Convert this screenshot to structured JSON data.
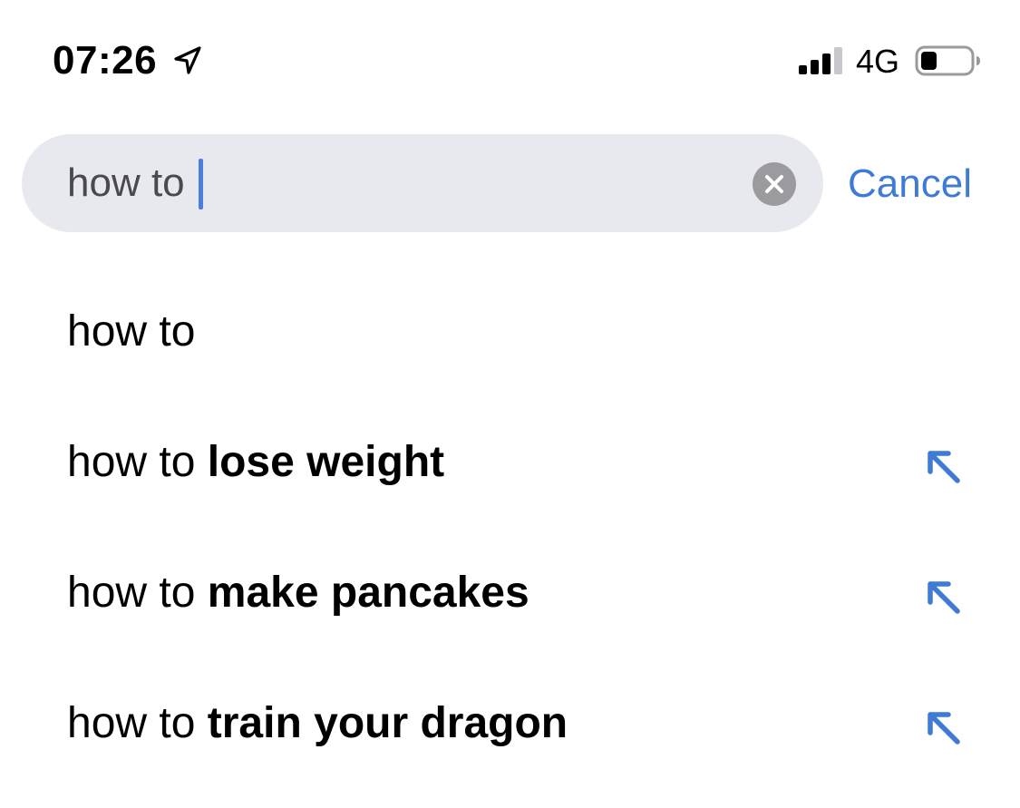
{
  "status_bar": {
    "time": "07:26",
    "network": "4G",
    "location_icon": "location-arrow-icon",
    "signal_icon": "cellular-signal-icon",
    "battery_icon": "battery-low-icon",
    "signal_bars_filled": 3,
    "signal_bars_total": 4,
    "battery_level": 0.2
  },
  "search": {
    "query": "how to",
    "clear_icon": "clear-circle-x-icon",
    "cancel_label": "Cancel",
    "field_color": "#e8e9ee",
    "accent_color": "#3f7bd6"
  },
  "suggestions": [
    {
      "prefix": "how to",
      "completion": "",
      "fill_icon": false
    },
    {
      "prefix": "how to ",
      "completion": "lose weight",
      "fill_icon": true
    },
    {
      "prefix": "how to ",
      "completion": "make pancakes",
      "fill_icon": true
    },
    {
      "prefix": "how to ",
      "completion": "train your dragon",
      "fill_icon": true
    }
  ]
}
